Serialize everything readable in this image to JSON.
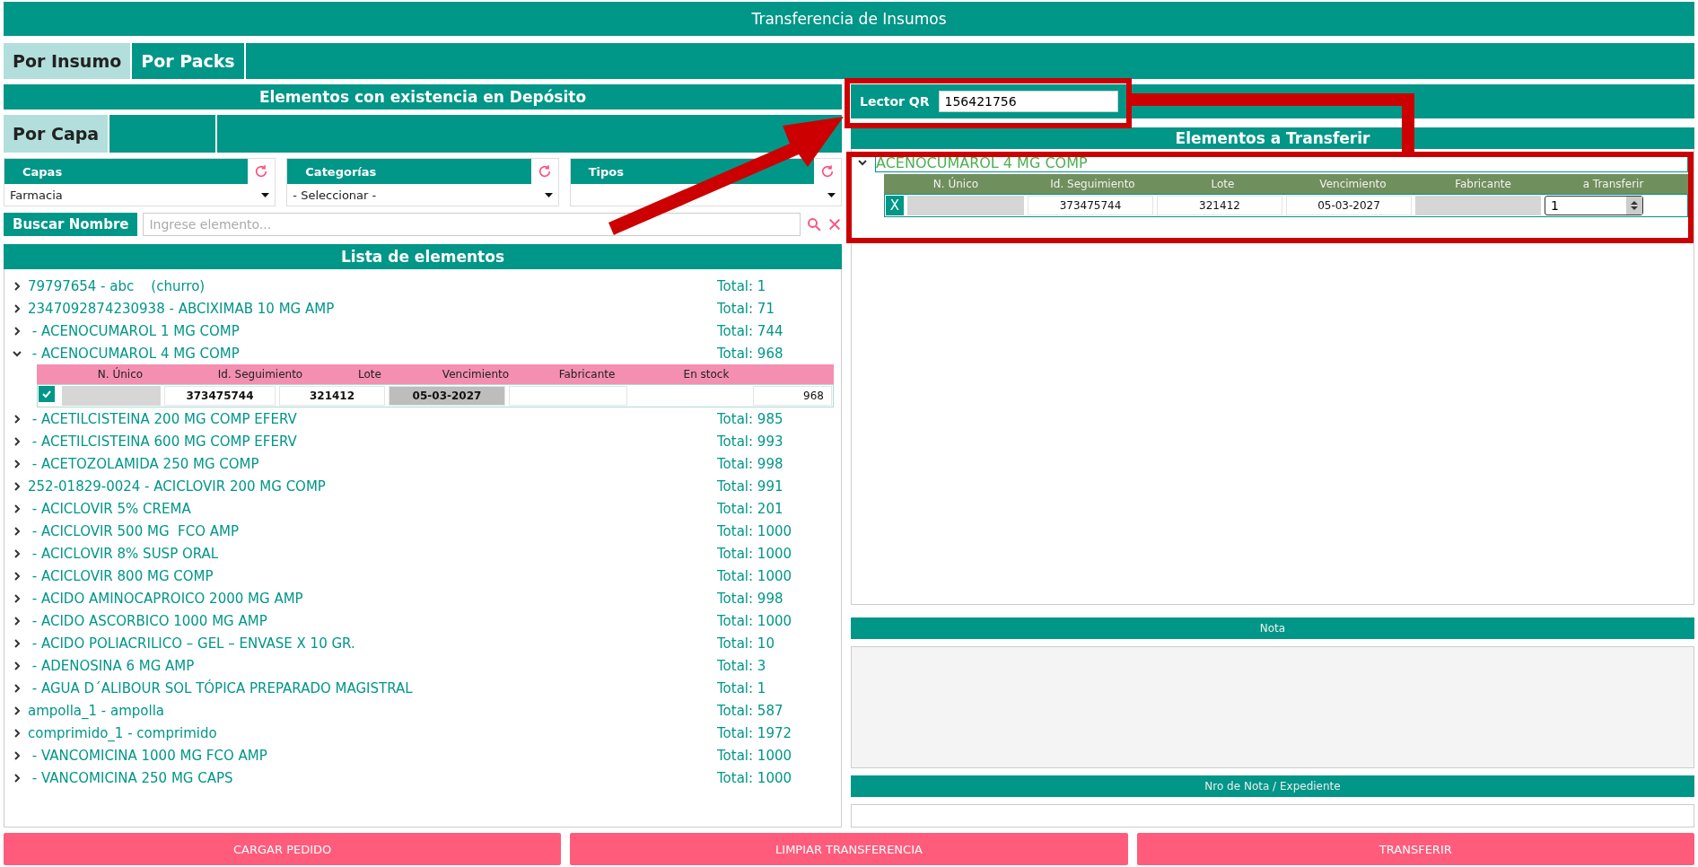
{
  "window": {
    "title": "Transferencia de Insumos"
  },
  "tabs": [
    {
      "label": "Por Insumo",
      "selected": true
    },
    {
      "label": "Por Packs",
      "selected": false
    }
  ],
  "stock_panel": {
    "title": "Elementos con existencia en Depósito",
    "subtabs": [
      {
        "label": "Por Capa",
        "selected": true
      }
    ],
    "filters": [
      {
        "label": "Capas",
        "value": "Farmacia"
      },
      {
        "label": "Categorías",
        "value": "- Seleccionar -"
      },
      {
        "label": "Tipos"
      }
    ],
    "search": {
      "label": "Buscar Nombre",
      "placeholder": "Ingrese elemento..."
    },
    "list_title": "Lista de elementos",
    "lot_columns": [
      "N. Único",
      "Id. Seguimiento",
      "Lote",
      "Vencimiento",
      "Fabricante",
      "En stock"
    ],
    "items": [
      {
        "name": "79797654 - abc    (churro)",
        "total": "Total: 1",
        "expanded": false
      },
      {
        "name": "2347092874230938 - ABCIXIMAB 10 MG AMP",
        "total": "Total: 71",
        "expanded": false
      },
      {
        "name": " - ACENOCUMAROL 1 MG COMP",
        "total": "Total: 744",
        "expanded": false
      },
      {
        "name": " - ACENOCUMAROL 4 MG COMP",
        "total": "Total: 968",
        "expanded": true,
        "lots": [
          {
            "checked": true,
            "id_seguimiento": "373475744",
            "lote": "321412",
            "vencimiento": "05-03-2027",
            "stock": "968"
          }
        ]
      },
      {
        "name": " - ACETILCISTEINA 200 MG COMP EFERV",
        "total": "Total: 985",
        "expanded": false
      },
      {
        "name": " - ACETILCISTEINA 600 MG COMP EFERV",
        "total": "Total: 993",
        "expanded": false
      },
      {
        "name": " - ACETOZOLAMIDA 250 MG COMP",
        "total": "Total: 998",
        "expanded": false
      },
      {
        "name": "252-01829-0024 - ACICLOVIR 200 MG COMP",
        "total": "Total: 991",
        "expanded": false
      },
      {
        "name": " - ACICLOVIR 5% CREMA",
        "total": "Total: 201",
        "expanded": false
      },
      {
        "name": " - ACICLOVIR 500 MG  FCO AMP",
        "total": "Total: 1000",
        "expanded": false
      },
      {
        "name": " - ACICLOVIR 8% SUSP ORAL",
        "total": "Total: 1000",
        "expanded": false
      },
      {
        "name": " - ACICLOVIR 800 MG COMP",
        "total": "Total: 1000",
        "expanded": false
      },
      {
        "name": " - ACIDO AMINOCAPROICO 2000 MG AMP",
        "total": "Total: 998",
        "expanded": false
      },
      {
        "name": " - ACIDO ASCORBICO 1000 MG AMP",
        "total": "Total: 1000",
        "expanded": false
      },
      {
        "name": " - ACIDO POLIACRILICO – GEL – ENVASE X 10 GR.",
        "total": "Total: 10",
        "expanded": false
      },
      {
        "name": " - ADENOSINA 6 MG AMP",
        "total": "Total: 3",
        "expanded": false
      },
      {
        "name": " - AGUA D´ALIBOUR SOL TÓPICA PREPARADO MAGISTRAL",
        "total": "Total: 1",
        "expanded": false
      },
      {
        "name": "ampolla_1 - ampolla",
        "total": "Total: 587",
        "expanded": false
      },
      {
        "name": "comprimido_1 - comprimido",
        "total": "Total: 1972",
        "expanded": false
      },
      {
        "name": " - VANCOMICINA 1000 MG FCO AMP",
        "total": "Total: 1000",
        "expanded": false
      },
      {
        "name": " - VANCOMICINA 250 MG CAPS",
        "total": "Total: 1000",
        "expanded": false
      }
    ]
  },
  "qr_reader": {
    "label": "Lector QR",
    "value": "156421756"
  },
  "transfer_panel": {
    "title": "Elementos a Transferir",
    "columns": [
      "N. Único",
      "Id. Seguimiento",
      "Lote",
      "Vencimiento",
      "Fabricante",
      "a Transferir"
    ],
    "groups": [
      {
        "name": "ACENOCUMAROL 4 MG COMP",
        "expanded": true,
        "rows": [
          {
            "remove": "X",
            "id_seguimiento": "373475744",
            "lote": "321412",
            "vencimiento": "05-03-2027",
            "quantity": "1"
          }
        ]
      }
    ]
  },
  "note": {
    "title": "Nota"
  },
  "expediente": {
    "title": "Nro de Nota / Expediente"
  },
  "buttons": [
    "CARGAR PEDIDO",
    "LIMPIAR TRANSFERENCIA",
    "TRANSFERIR"
  ]
}
